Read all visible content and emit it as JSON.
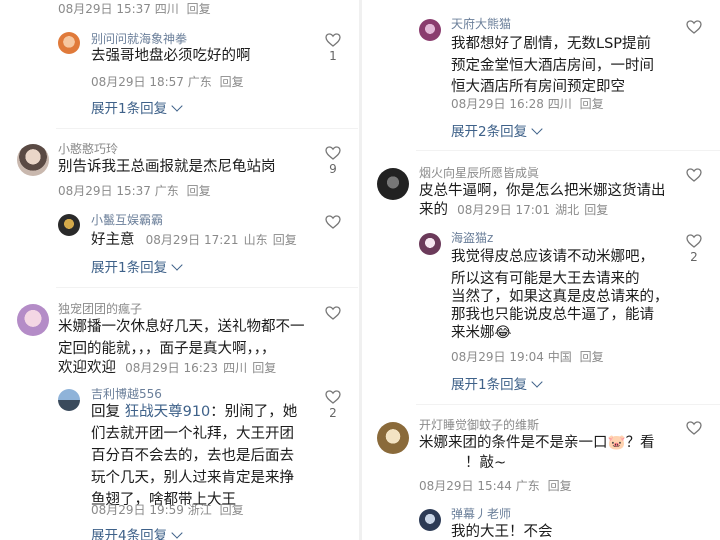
{
  "left": {
    "top_meta": {
      "date": "08月29日 15:37",
      "location": "四川",
      "reply": "回复"
    },
    "c1_reply": {
      "user": "别问问就海象神拳",
      "text": "去强哥地盘必须吃好的啊",
      "date": "08月29日 18:57",
      "location": "广东",
      "reply": "回复",
      "likes": "1"
    },
    "c1_expand": "展开1条回复",
    "c2": {
      "user": "小憨憨巧玲",
      "text": "别告诉我王总画报就是杰尼龟站岗",
      "date": "08月29日 15:37",
      "location": "广东",
      "reply": "回复",
      "likes": "9"
    },
    "c2_reply": {
      "user": "小鬣互娱霸霸",
      "text": "好主意",
      "date": "08月29日 17:21",
      "location": "山东",
      "reply": "回复"
    },
    "c2_expand": "展开1条回复",
    "c3": {
      "user": "独宠团团的瘋子",
      "lines": [
        "米娜播一次休息好几天，送礼物都不一",
        "定回的能就，，，面子是真大啊，，，"
      ],
      "line3": "欢迎欢迎",
      "date": "08月29日 16:23",
      "location": "四川",
      "reply": "回复"
    },
    "c3_reply": {
      "user": "吉利博越556",
      "reply_prefix": "回复",
      "reply_to": "狂战天尊910",
      "colon": "：别闹了，她",
      "lines": [
        "们去就开团一个礼拜，大王开团",
        "百分百不会去的，去也是后面去",
        "玩个几天，别人过来肯定是来挣",
        "鱼翅了，啥都带上大王"
      ],
      "date": "08月29日 19:59",
      "location": "浙江",
      "reply": "回复",
      "likes": "2"
    },
    "c3_expand": "展开4条回复"
  },
  "right": {
    "c1": {
      "user": "天府大熊猫",
      "lines": [
        "我都想好了剧情，无数LSP提前",
        "预定金堂恒大酒店房间，一时间",
        "恒大酒店所有房间预定即空"
      ],
      "date": "08月29日 16:28",
      "location": "四川",
      "reply": "回复"
    },
    "c1_expand": "展开2条回复",
    "c2": {
      "user": "烟火向星辰所愿皆成眞",
      "line1": "皮总牛逼啊，你是怎么把米娜这货请出",
      "line2_text": "来的",
      "date": "08月29日 17:01",
      "location": "湖北",
      "reply": "回复"
    },
    "c2_reply": {
      "user": "海盗猫z",
      "lines": [
        "我觉得皮总应该请不动米娜吧，",
        "所以这有可能是大王去请来的",
        "当然了，如果这真是皮总请来的，",
        "那我也只能说皮总牛逼了，能请",
        "来米娜"
      ],
      "emoji": "😂",
      "date": "08月29日 19:04",
      "location": "中国",
      "reply": "回复",
      "likes": "2"
    },
    "c2_expand": "展开1条回复",
    "c3": {
      "user": "开灯睡觉御蚊子的维斯",
      "line1": "米娜来团的条件是不是亲一口",
      "emoji": "🐷",
      "line1_end": "？看",
      "line2": "！敲~",
      "date": "08月29日 15:44",
      "location": "广东",
      "reply": "回复"
    },
    "c3_reply": {
      "user": "弹幕丿老师",
      "text": "我的大王！不会"
    }
  },
  "colors": {
    "link": "#3e6189",
    "meta": "#8a8a8a",
    "text": "#1b1b1b"
  }
}
